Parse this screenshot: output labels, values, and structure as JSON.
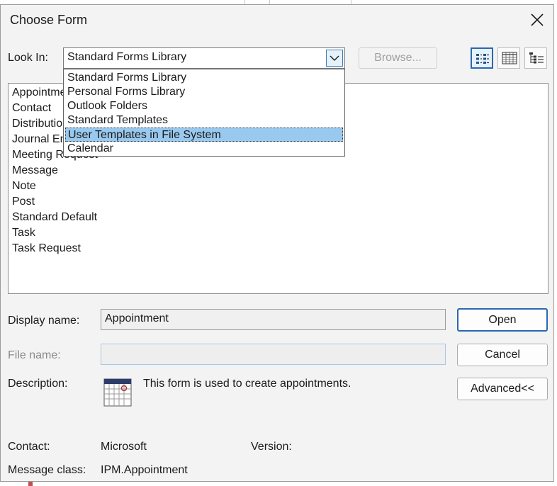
{
  "dialog": {
    "title": "Choose Form",
    "look_in_label": "Look In:",
    "look_in_value": "Standard Forms Library",
    "browse_label": "Browse...",
    "view_buttons": [
      "list-view-icon",
      "details-view-icon",
      "tree-view-icon"
    ]
  },
  "dropdown": {
    "items": [
      "Standard Forms Library",
      "Personal Forms Library",
      "Outlook Folders",
      "Standard Templates",
      "User Templates in File System",
      "Calendar"
    ],
    "selected_index": 4
  },
  "form_list": {
    "items": [
      "Appointment",
      "Contact",
      "Distribution List",
      "Journal Entry",
      "Meeting Request",
      "Message",
      "Note",
      "Post",
      "Standard Default",
      "Task",
      "Task Request"
    ]
  },
  "details": {
    "display_name_label": "Display name:",
    "display_name_value": "Appointment",
    "file_name_label": "File name:",
    "file_name_value": "",
    "description_label": "Description:",
    "description_text": "This form is used to create appointments.",
    "contact_label": "Contact:",
    "contact_value": "Microsoft",
    "version_label": "Version:",
    "version_value": "",
    "message_class_label": "Message class:",
    "message_class_value": "IPM.Appointment"
  },
  "buttons": {
    "open": "Open",
    "cancel": "Cancel",
    "advanced": "Advanced<<"
  },
  "colors": {
    "dialog_bg": "#f3f3f3",
    "selection": "#99c9ef",
    "accent": "#2a67b1"
  }
}
